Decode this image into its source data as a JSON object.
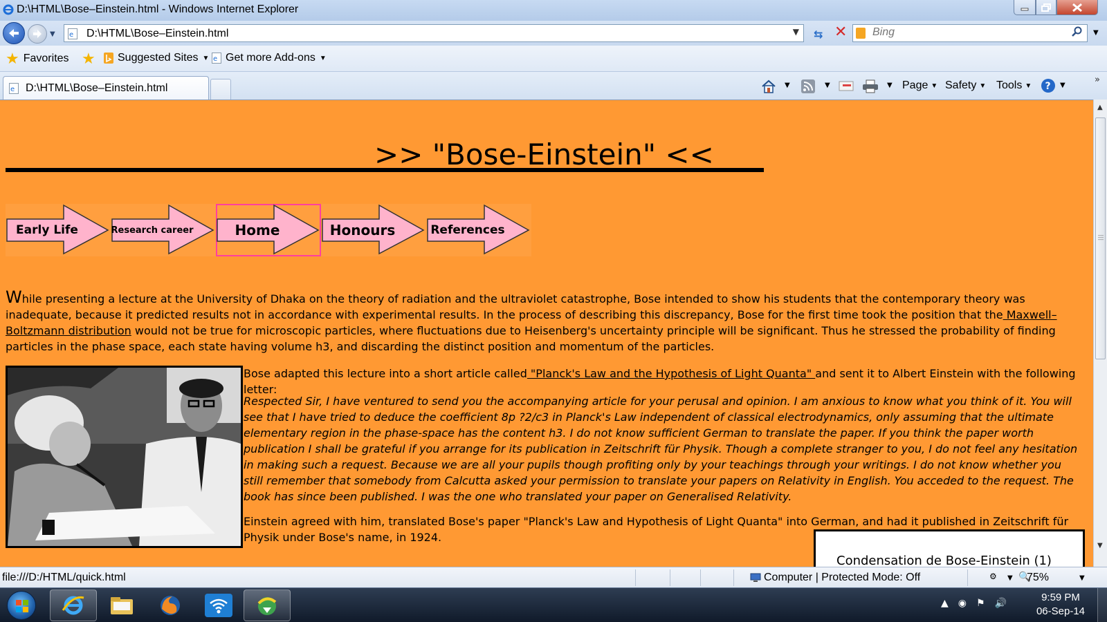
{
  "window": {
    "title": "D:\\HTML\\Bose–Einstein.html - Windows Internet Explorer"
  },
  "address_bar": {
    "url": "D:\\HTML\\Bose–Einstein.html",
    "search_placeholder": "Bing"
  },
  "favorites_bar": {
    "favorites_label": "Favorites",
    "items": [
      {
        "label": "Suggested Sites",
        "icon": "bing-icon"
      },
      {
        "label": "Get more Add-ons",
        "icon": "ie-page-icon"
      }
    ]
  },
  "tabs": [
    {
      "label": "D:\\HTML\\Bose–Einstein.html",
      "active": true
    }
  ],
  "command_bar": {
    "page_label": "Page",
    "safety_label": "Safety",
    "tools_label": "Tools",
    "icons": [
      "home-icon",
      "rss-feed-icon",
      "read-mail-icon",
      "print-icon",
      "help-icon"
    ]
  },
  "page": {
    "background_color": "#ff9933",
    "heading": ">> \"Bose-Einstein\" <<",
    "nav": [
      {
        "label": "Early Life",
        "current": false
      },
      {
        "label": "Research career",
        "current": false
      },
      {
        "label": "Home",
        "current": true
      },
      {
        "label": "Honours",
        "current": false
      },
      {
        "label": "References",
        "current": false
      }
    ],
    "para1": {
      "dropcap": "W",
      "before_link": "hile presenting a lecture at the University of Dhaka on the theory of radiation and the ultraviolet catastrophe, Bose intended to show his students that the contemporary theory was inadequate, because it predicted results not in accordance with experimental results. In the process of describing this discrepancy, Bose for the first time took the position that the",
      "link": " Maxwell–Boltzmann distribution",
      "after_link": " would not be true for microscopic particles, where fluctuations due to Heisenberg's uncertainty principle will be significant. Thus he stressed the probability of finding particles in the phase space, each state having volume h3, and discarding the distinct position and momentum of the particles."
    },
    "photo_alt": "Einstein and Bose",
    "para2": {
      "before_link": "Bose adapted this lecture into a short article called",
      "link": " \"Planck's Law and the Hypothesis of Light Quanta\" ",
      "after_link": "and sent it to Albert Einstein with the following letter:"
    },
    "letter": "Respected Sir, I have ventured to send you the accompanying article for your perusal and opinion. I am anxious to know what you think of it. You will see that I have tried to deduce the coefficient 8p ?2/c3 in Planck's Law independent of classical electrodynamics, only assuming that the ultimate elementary region in the phase-space has the content h3. I do not know sufficient German to translate the paper. If you think the paper worth publication I shall be grateful if you arrange for its publication in Zeitschrift für Physik. Though a complete stranger to you, I do not feel any hesitation in making such a request. Because we are all your pupils though profiting only by your teachings through your writings. I do not know whether you still remember that somebody from Calcutta asked your permission to translate your papers on Relativity in English. You acceded to the request. The book has since been published. I was the one who translated your paper on Generalised Relativity.",
    "para3": "Einstein agreed with him, translated Bose's paper \"Planck's Law and Hypothesis of Light Quanta\" into German, and had it published in Zeitschrift für Physik under Bose's name, in 1924.",
    "quickbox_title": "Condensation de Bose-Einstein (1)"
  },
  "status_bar": {
    "url": "file:///D:/HTML/quick.html",
    "zone": "Computer | Protected Mode: Off",
    "zoom": "75%"
  },
  "taskbar": {
    "apps": [
      "internet-explorer",
      "file-explorer",
      "firefox",
      "wifi-manager",
      "download-manager"
    ],
    "time": "9:59 PM",
    "date": "06-Sep-14"
  }
}
